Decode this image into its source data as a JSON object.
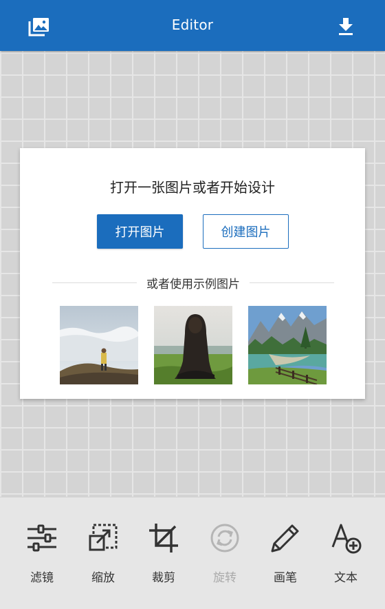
{
  "header": {
    "title": "Editor",
    "left_icon": "gallery-icon",
    "right_icon": "download-icon",
    "color": "#1b6dbd"
  },
  "card": {
    "prompt": "打开一张图片或者开始设计",
    "open_button": "打开图片",
    "create_button": "创建图片",
    "samples_label": "或者使用示例图片",
    "samples": [
      {
        "name": "sample-image-mountain-clouds"
      },
      {
        "name": "sample-image-woman-meadow"
      },
      {
        "name": "sample-image-lake-mountains"
      }
    ]
  },
  "toolbar": {
    "tools": [
      {
        "label": "滤镜",
        "icon": "sliders-icon",
        "enabled": true
      },
      {
        "label": "缩放",
        "icon": "resize-icon",
        "enabled": true
      },
      {
        "label": "裁剪",
        "icon": "crop-icon",
        "enabled": true
      },
      {
        "label": "旋转",
        "icon": "rotate-icon",
        "enabled": false
      },
      {
        "label": "画笔",
        "icon": "pencil-icon",
        "enabled": true
      },
      {
        "label": "文本",
        "icon": "add-text-icon",
        "enabled": true
      }
    ]
  }
}
